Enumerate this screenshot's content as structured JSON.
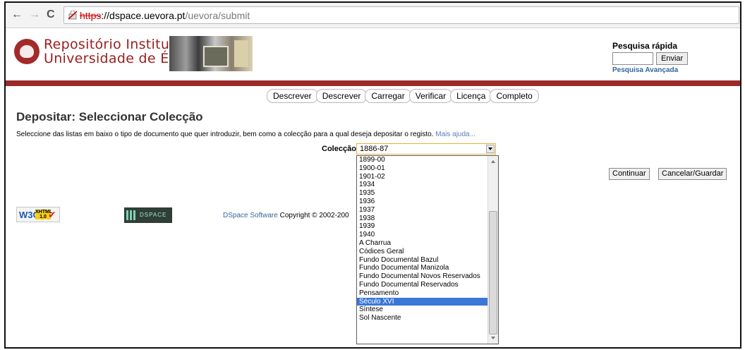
{
  "browser": {
    "back_glyph": "←",
    "forward_glyph": "→",
    "reload_glyph": "C",
    "url_scheme": "https",
    "url_host": "://dspace.uevora.pt",
    "url_path": "/uevora/submit"
  },
  "header": {
    "title_line1": "Repositório Institucional",
    "title_line2": "Universidade de Évora",
    "quick_search": {
      "label": "Pesquisa rápida",
      "input_value": "",
      "button_label": "Enviar",
      "advanced_link": "Pesquisa Avançada"
    }
  },
  "steps": [
    "Descrever",
    "Descrever",
    "Carregar",
    "Verificar",
    "Licença",
    "Completo"
  ],
  "page": {
    "title": "Depositar: Seleccionar Colecção",
    "intro": "Seleccione das listas em baixo o tipo de documento que quer introduzir, bem como a colecção para a qual deseja depositar o registo.",
    "help_link": "Mais ajuda...",
    "collection_label": "Colecção",
    "selected_value": "1886-87",
    "options": [
      "1899-00",
      "1900-01",
      "1901-02",
      "1934",
      "1935",
      "1936",
      "1937",
      "1938",
      "1939",
      "1940",
      "A Charrua",
      "Códices Geral",
      "Fundo Documental Bazul",
      "Fundo Documental Manizola",
      "Fundo Documental Novos Reservados",
      "Fundo Documental Reservados",
      "Pensamento",
      "Século XVI",
      "Síntese",
      "Sol Nascente"
    ],
    "highlighted_option": "Século XVI",
    "continue_label": "Continuar",
    "cancel_label": "Cancelar/Guardar"
  },
  "footer": {
    "w3c_text": "W3C",
    "xhtml_text": "XHTML 1.0",
    "dspace_text": "DSPACE",
    "link_text": "DSpace Software",
    "copyright_text": " Copyright © 2002-200"
  },
  "colors": {
    "brand_red": "#9b2b2b",
    "link_blue": "#33669a",
    "selection_blue": "#3a78d7"
  }
}
